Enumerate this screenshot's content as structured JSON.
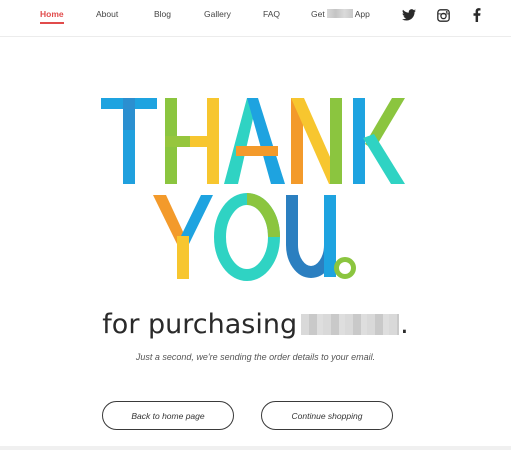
{
  "nav": {
    "items": [
      {
        "label": "Home",
        "active": true
      },
      {
        "label": "About"
      },
      {
        "label": "Blog"
      },
      {
        "label": "Gallery"
      },
      {
        "label": "FAQ"
      }
    ],
    "app_link": {
      "prefix": "Get",
      "suffix": "App"
    },
    "social": [
      "twitter-icon",
      "instagram-icon",
      "facebook-icon"
    ],
    "active_color": "#e14b4b"
  },
  "hero": {
    "line1": "THANK",
    "line2": "YOU",
    "subline_prefix": "for purchasing",
    "subline_suffix": ".",
    "note": "Just a second, we're sending the order details to your email.",
    "colors": [
      "#1ea3e0",
      "#8bc53f",
      "#f7c62f",
      "#2fd3c3",
      "#f39a2b",
      "#2b7fc0"
    ]
  },
  "buttons": {
    "back": "Back to home page",
    "continue": "Continue shopping"
  }
}
